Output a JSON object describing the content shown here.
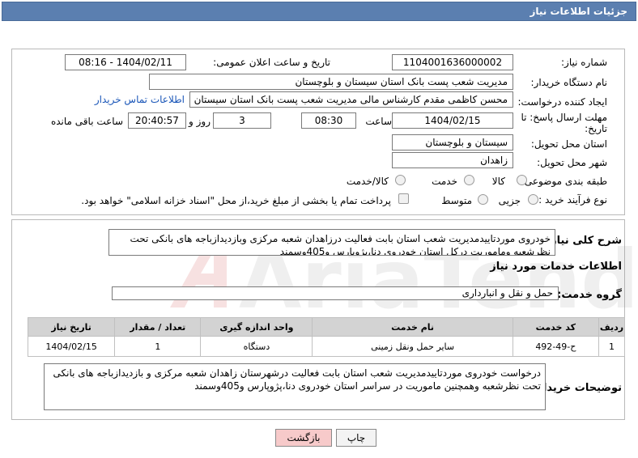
{
  "header": {
    "title": "جزئیات اطلاعات نیاز"
  },
  "form": {
    "need_number_label": "شماره نیاز:",
    "need_number_value": "1104001636000002",
    "announce_label": "تاریخ و ساعت اعلان عمومی:",
    "announce_value": "1404/02/11 - 08:16",
    "buyer_org_label": "نام دستگاه خریدار:",
    "buyer_org_value": "مدیریت شعب پست بانک استان سیستان و بلوچستان",
    "creator_label": "ایجاد کننده درخواست:",
    "creator_value": "محسن کاظمی مقدم کارشناس مالی مدیریت شعب پست بانک استان سیستان و بلوچستان",
    "contact_link": "اطلاعات تماس خریدار",
    "deadline_label_1": "مهلت ارسال پاسخ: تا",
    "deadline_label_2": "تاریخ:",
    "deadline_date": "1404/02/15",
    "time_label": "ساعت",
    "deadline_time": "08:30",
    "days_value": "3",
    "days_label": "روز و",
    "remaining_time": "20:40:57",
    "remaining_label": "ساعت باقی مانده",
    "province_label": "استان محل تحویل:",
    "province_value": "سیستان و بلوچستان",
    "city_label": "شهر محل تحویل:",
    "city_value": "زاهدان",
    "category_label": "طبقه بندی موضوعی:",
    "category_options": [
      "کالا",
      "خدمت",
      "کالا/خدمت"
    ],
    "process_label": "نوع فرآیند خرید :",
    "process_options": [
      "جزیی",
      "متوسط"
    ],
    "payment_note": "پرداخت تمام یا بخشی از مبلغ خرید،از محل \"اسناد خزانه اسلامی\" خواهد بود."
  },
  "summary": {
    "label": "شرح کلی نیاز:",
    "text": "خودروی موردتاییدمدیریت شعب استان بابت فعالیت درزاهدان شعبه مرکزی وبازدیدازباجه های بانکی تحت نظرشعبه وماموریت درکل استان خودروی دنا،پژوپارس و405وسمند"
  },
  "services": {
    "section_title": "اطلاعات خدمات مورد نیاز",
    "group_label": "گروه خدمت:",
    "group_value": "حمل و نقل و انبارداری",
    "columns": [
      "ردیف",
      "کد خدمت",
      "نام خدمت",
      "واحد اندازه گیری",
      "تعداد / مقدار",
      "تاریخ نیاز"
    ],
    "rows": [
      [
        "1",
        "ح-49-492",
        "سایر حمل ونقل زمینی",
        "دستگاه",
        "1",
        "1404/02/15"
      ]
    ]
  },
  "buyer_notes": {
    "label": "توضیحات خریدار:",
    "text": "درخواست خودروی موردتاییدمدیریت شعب استان بابت فعالیت درشهرستان زاهدان شعبه مرکزی و بازدیدازباجه های بانکی تحت نظرشعبه وهمچنین ماموریت در سراسر استان خودروی دنا،پژوپارس و405وسمند"
  },
  "buttons": {
    "print": "چاپ",
    "back": "بازگشت"
  },
  "watermark": {
    "text": "AriaTender.neT"
  },
  "colors": {
    "header": "#5b7fb0",
    "link": "#1a56b8",
    "back_button": "#f7caca"
  }
}
